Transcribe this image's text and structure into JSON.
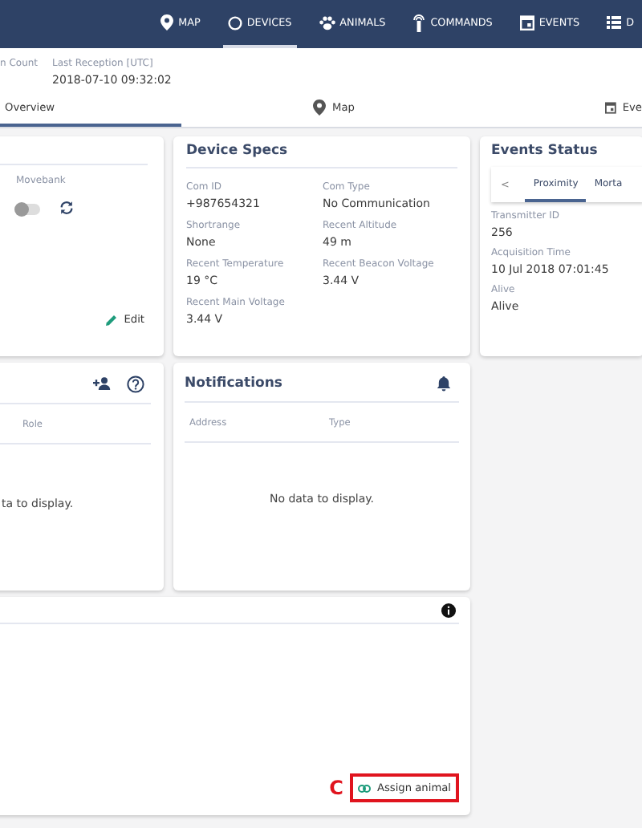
{
  "nav": {
    "items": [
      {
        "label": "MAP",
        "selected": false
      },
      {
        "label": "DEVICES",
        "selected": true
      },
      {
        "label": "ANIMALS",
        "selected": false
      },
      {
        "label": "COMMANDS",
        "selected": false
      },
      {
        "label": "EVENTS",
        "selected": false
      },
      {
        "label": "D",
        "selected": false
      }
    ]
  },
  "header": {
    "fields": [
      {
        "label": "n Count"
      },
      {
        "label": "Last Reception [UTC]",
        "value": "2018-07-10 09:32:02"
      }
    ]
  },
  "tabs": [
    {
      "label": "Overview",
      "selected": true
    },
    {
      "label": "Map",
      "selected": false
    },
    {
      "label": "Eve",
      "selected": false
    }
  ],
  "device_card": {
    "movebank_label": "Movebank",
    "movebank_on": false,
    "edit": "Edit"
  },
  "device_specs": {
    "title": "Device Specs",
    "fields": [
      {
        "label": "Com ID",
        "value": "+987654321"
      },
      {
        "label": "Com Type",
        "value": "No Communication"
      },
      {
        "label": "Shortrange",
        "value": "None"
      },
      {
        "label": "Recent Altitude",
        "value": "49 m"
      },
      {
        "label": "Recent Temperature",
        "value": "19 °C"
      },
      {
        "label": "Recent Beacon Voltage",
        "value": "3.44 V"
      },
      {
        "label": "Recent Main Voltage",
        "value": "3.44 V"
      }
    ]
  },
  "events_status": {
    "title": "Events Status",
    "prev": "<",
    "tabs": [
      {
        "label": "Proximity",
        "selected": true
      },
      {
        "label": "Morta",
        "selected": false
      }
    ],
    "fields": [
      {
        "label": "Transmitter ID",
        "value": "256"
      },
      {
        "label": "Acquisition Time",
        "value": "10 Jul 2018 07:01:45"
      },
      {
        "label": "Alive",
        "value": "Alive"
      }
    ]
  },
  "contacts_card": {
    "columns": [
      "Role"
    ],
    "empty": "ta to display."
  },
  "notifications": {
    "title": "Notifications",
    "columns": [
      "Address",
      "Type"
    ],
    "empty": "No data to display."
  },
  "animal_card": {
    "assign_button": "Assign animal",
    "annotation": "C"
  }
}
